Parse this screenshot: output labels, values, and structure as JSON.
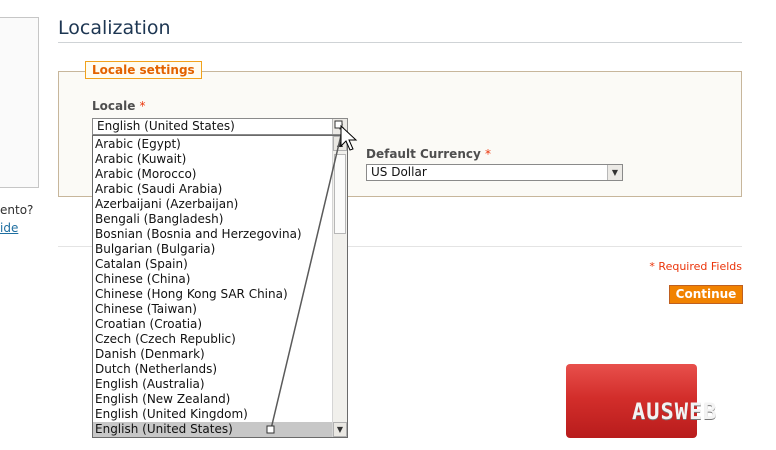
{
  "sidebar": {
    "text_fragment": "ento?",
    "link_fragment": "ide"
  },
  "page": {
    "title": "Localization"
  },
  "locale_settings": {
    "legend": "Locale settings",
    "locale_label": "Locale",
    "required_mark": "*",
    "locale_selected": "English (United States)",
    "currency_label": "Default Currency",
    "currency_selected": "US Dollar",
    "dropdown_options": [
      "Arabic (Egypt)",
      "Arabic (Kuwait)",
      "Arabic (Morocco)",
      "Arabic (Saudi Arabia)",
      "Azerbaijani (Azerbaijan)",
      "Bengali (Bangladesh)",
      "Bosnian (Bosnia and Herzegovina)",
      "Bulgarian (Bulgaria)",
      "Catalan (Spain)",
      "Chinese (China)",
      "Chinese (Hong Kong SAR China)",
      "Chinese (Taiwan)",
      "Croatian (Croatia)",
      "Czech (Czech Republic)",
      "Danish (Denmark)",
      "Dutch (Netherlands)",
      "English (Australia)",
      "English (New Zealand)",
      "English (United Kingdom)",
      "English (United States)"
    ],
    "selected_index": 19
  },
  "form": {
    "required_fields_note": "* Required Fields",
    "continue_label": "Continue"
  },
  "watermark": {
    "text": "AUSWEB"
  },
  "colors": {
    "accent": "#f18200",
    "title": "#1d3652",
    "required": "#eb340a",
    "legend_border": "#f1a21c"
  }
}
